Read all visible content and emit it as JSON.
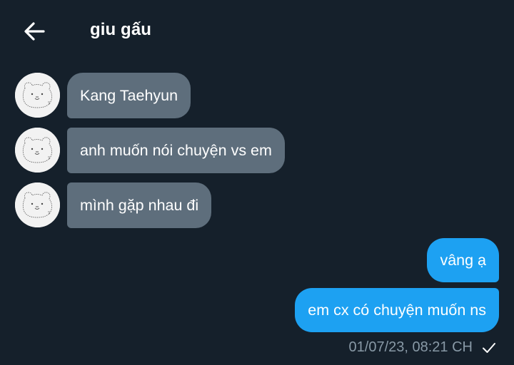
{
  "header": {
    "back_icon": "arrow-left-icon",
    "title": "giu gấu"
  },
  "messages_received": [
    {
      "text": "Kang Taehyun",
      "avatar_icon": "bear-sketch-avatar"
    },
    {
      "text": "anh muốn nói chuyện vs em",
      "avatar_icon": "bear-sketch-avatar"
    },
    {
      "text": "mình gặp nhau đi",
      "avatar_icon": "bear-sketch-avatar"
    }
  ],
  "messages_sent": [
    {
      "text": "vâng ạ"
    },
    {
      "text": "em cx có chuyện muốn ns"
    }
  ],
  "status": {
    "timestamp": "01/07/23, 08:21 CH",
    "read_icon": "checkmark-icon"
  },
  "colors": {
    "background": "#15202b",
    "incoming_bubble": "#5e6e7c",
    "outgoing_bubble": "#1da1f2",
    "meta_text": "#8899a6"
  }
}
